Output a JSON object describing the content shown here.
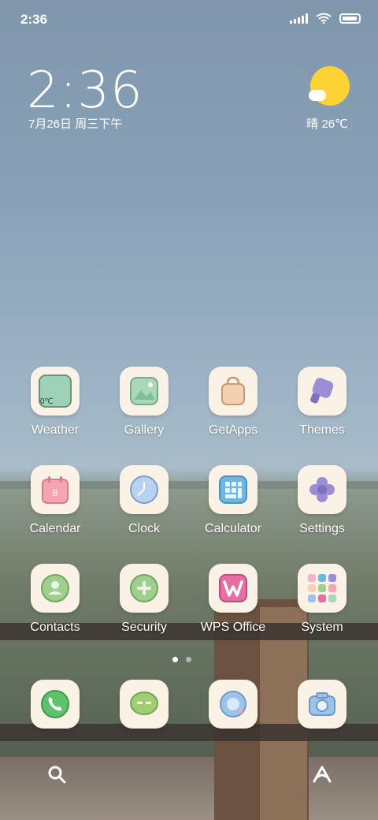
{
  "status_bar": {
    "time": "2:36",
    "icons": [
      "signal-icon",
      "wifi-icon",
      "battery-icon"
    ]
  },
  "clock_widget": {
    "time": "2:36",
    "date": "7月26日 周三下午"
  },
  "weather_widget": {
    "icon": "sun-cloud-icon",
    "text": "晴 26℃"
  },
  "apps": [
    {
      "name": "weather",
      "label": "Weather",
      "icon": "weather-icon",
      "color": "#9ed2b8",
      "badge": "0℃"
    },
    {
      "name": "gallery",
      "label": "Gallery",
      "icon": "gallery-icon",
      "color": "#a9d8b8"
    },
    {
      "name": "getapps",
      "label": "GetApps",
      "icon": "shopping-bag-icon",
      "color": "#f3d1b0"
    },
    {
      "name": "themes",
      "label": "Themes",
      "icon": "themes-icon",
      "color": "#9b8ed6"
    },
    {
      "name": "calendar",
      "label": "Calendar",
      "icon": "calendar-icon",
      "color": "#f4a4b2",
      "badge": "8"
    },
    {
      "name": "clock",
      "label": "Clock",
      "icon": "clock-icon",
      "color": "#b8d2ef"
    },
    {
      "name": "calculator",
      "label": "Calculator",
      "icon": "calculator-icon",
      "color": "#6fb7e0"
    },
    {
      "name": "settings",
      "label": "Settings",
      "icon": "gear-icon",
      "color": "#9b8ed6"
    },
    {
      "name": "contacts",
      "label": "Contacts",
      "icon": "contacts-icon",
      "color": "#9fcf8f"
    },
    {
      "name": "security",
      "label": "Security",
      "icon": "security-icon",
      "color": "#9fcf8f"
    },
    {
      "name": "wps",
      "label": "WPS Office",
      "icon": "wps-icon",
      "color": "#e46fa0"
    },
    {
      "name": "system",
      "label": "System",
      "icon": "folder-grid-icon",
      "color": "#f0b6c8"
    }
  ],
  "dock": [
    {
      "name": "phone",
      "icon": "phone-icon",
      "color": "#5cc26b"
    },
    {
      "name": "messages",
      "icon": "message-icon",
      "color": "#9fcf6f"
    },
    {
      "name": "browser",
      "icon": "browser-icon",
      "color": "#9cc4ea"
    },
    {
      "name": "camera",
      "icon": "camera-icon",
      "color": "#9cc4ea"
    }
  ],
  "page_indicator": {
    "pages": 2,
    "current": 1
  },
  "bottom_bar": {
    "left": "search-icon",
    "right": "assistant-icon"
  }
}
